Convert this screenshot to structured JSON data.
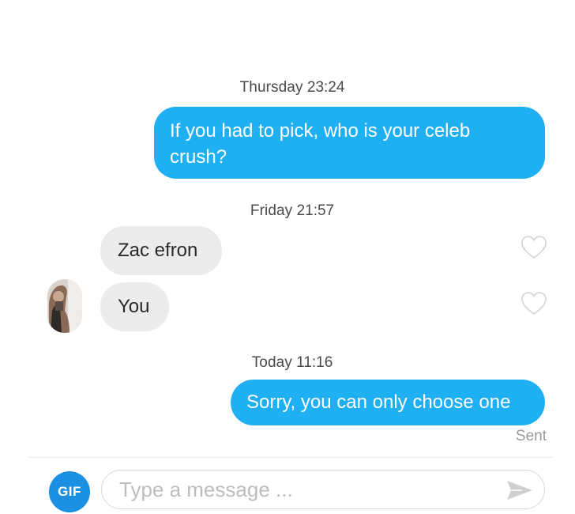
{
  "conversation": {
    "groups": [
      {
        "timestamp_day": "Thursday",
        "timestamp_time": "23:24"
      },
      {
        "timestamp_day": "Friday",
        "timestamp_time": "21:57"
      },
      {
        "timestamp_day": "Today",
        "timestamp_time": "11:16"
      }
    ],
    "messages": [
      {
        "direction": "outgoing",
        "text_line1": "If you had to pick, who is your celeb",
        "text_line2": "crush?"
      },
      {
        "direction": "incoming",
        "text": "Zac efron"
      },
      {
        "direction": "incoming",
        "text": "You"
      },
      {
        "direction": "outgoing",
        "text": "Sorry, you can only choose one"
      }
    ],
    "status": "Sent"
  },
  "composer": {
    "gif_label": "GIF",
    "placeholder": "Type a message ..."
  },
  "colors": {
    "outgoing_bubble": "#1fb0f3",
    "incoming_bubble": "#ececec",
    "gif_button": "#1b8fe2"
  },
  "icons": {
    "like": "heart-outline-icon",
    "send": "paper-plane-icon"
  }
}
